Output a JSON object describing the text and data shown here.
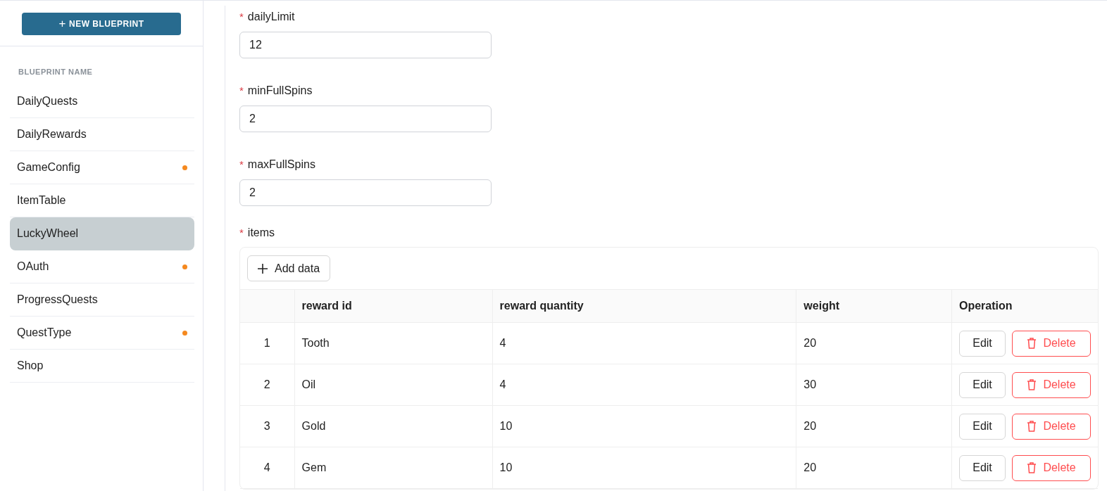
{
  "sidebar": {
    "new_button": {
      "icon": "+",
      "label": "NEW BLUEPRINT"
    },
    "header": "BLUEPRINT NAME",
    "items": [
      {
        "label": "DailyQuests",
        "selected": false,
        "modified": false
      },
      {
        "label": "DailyRewards",
        "selected": false,
        "modified": false
      },
      {
        "label": "GameConfig",
        "selected": false,
        "modified": true
      },
      {
        "label": "ItemTable",
        "selected": false,
        "modified": false
      },
      {
        "label": "LuckyWheel",
        "selected": true,
        "modified": false
      },
      {
        "label": "OAuth",
        "selected": false,
        "modified": true
      },
      {
        "label": "ProgressQuests",
        "selected": false,
        "modified": false
      },
      {
        "label": "QuestType",
        "selected": false,
        "modified": true
      },
      {
        "label": "Shop",
        "selected": false,
        "modified": false
      }
    ]
  },
  "fields": [
    {
      "mark": "*",
      "label": "dailyLimit",
      "value": "12"
    },
    {
      "mark": "*",
      "label": "minFullSpins",
      "value": "2"
    },
    {
      "mark": "*",
      "label": "maxFullSpins",
      "value": "2"
    }
  ],
  "items": {
    "mark": "*",
    "label": "items",
    "add_button": "Add data",
    "columns": [
      "reward id",
      "reward quantity",
      "weight",
      "Operation"
    ],
    "rows": [
      {
        "index": "1",
        "reward_id": "Tooth",
        "reward_quantity": "4",
        "weight": "20",
        "edit": "Edit",
        "delete": "Delete"
      },
      {
        "index": "2",
        "reward_id": "Oil",
        "reward_quantity": "4",
        "weight": "30",
        "edit": "Edit",
        "delete": "Delete"
      },
      {
        "index": "3",
        "reward_id": "Gold",
        "reward_quantity": "10",
        "weight": "20",
        "edit": "Edit",
        "delete": "Delete"
      },
      {
        "index": "4",
        "reward_id": "Gem",
        "reward_quantity": "10",
        "weight": "20",
        "edit": "Edit",
        "delete": "Delete"
      }
    ]
  }
}
